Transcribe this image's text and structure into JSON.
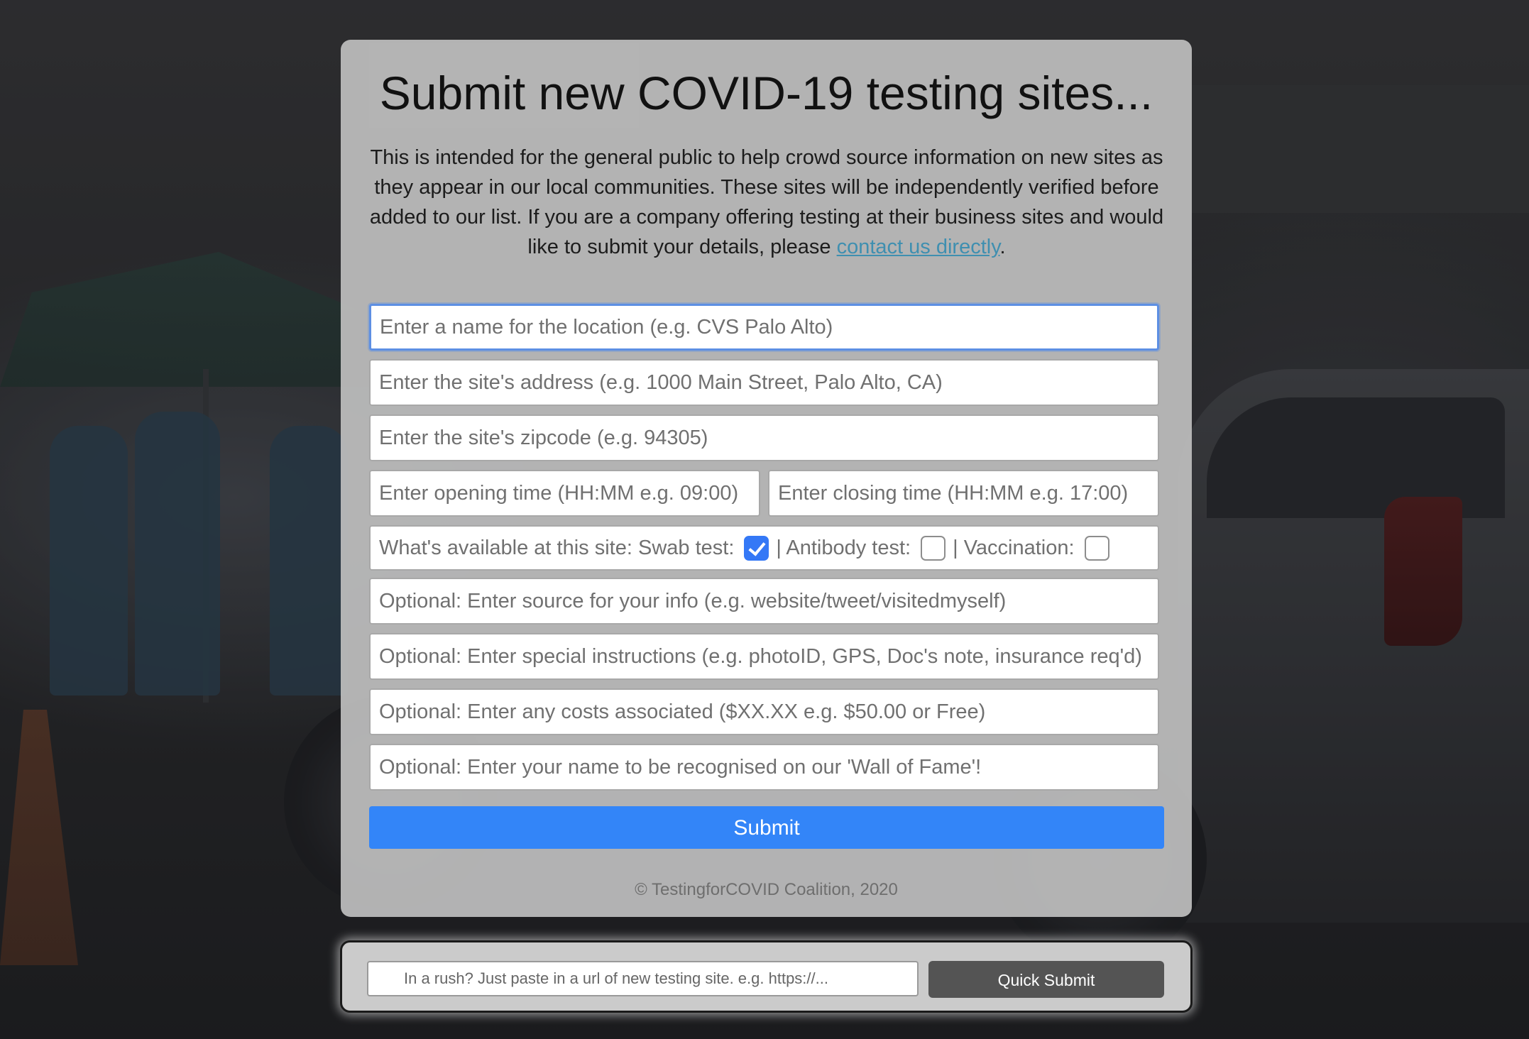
{
  "page": {
    "title": "Submit new COVID-19 testing sites...",
    "intro_text": "This is intended for the general public to help crowd source information on new sites as they appear in our local communities. These sites will be independently verified before added to our list. If you are a company offering testing at their business sites and would like to submit your details, please ",
    "intro_link": "contact us directly",
    "intro_end": "."
  },
  "form": {
    "location_name": {
      "value": "",
      "placeholder": "Enter a name for the location (e.g. CVS Palo Alto)"
    },
    "address": {
      "value": "",
      "placeholder": "Enter the site's address (e.g. 1000 Main Street, Palo Alto, CA)"
    },
    "zipcode": {
      "value": "",
      "placeholder": "Enter the site's zipcode (e.g. 94305)"
    },
    "opening_time": {
      "value": "",
      "placeholder": "Enter opening time (HH:MM e.g. 09:00)"
    },
    "closing_time": {
      "value": "",
      "placeholder": "Enter closing time (HH:MM e.g. 17:00)"
    },
    "availability": {
      "label": "What's available at this site: Swab test:",
      "antibody_label": "| Antibody test:",
      "vaccination_label": "| Vaccination:",
      "swab_checked": true,
      "antibody_checked": false,
      "vaccination_checked": false
    },
    "source": {
      "value": "",
      "placeholder": "Optional: Enter source for your info (e.g. website/tweet/visitedmyself)"
    },
    "instructions": {
      "value": "",
      "placeholder": "Optional: Enter special instructions (e.g. photoID, GPS, Doc's note, insurance req'd)"
    },
    "costs": {
      "value": "",
      "placeholder": "Optional: Enter any costs associated ($XX.XX e.g. $50.00 or Free)"
    },
    "contributor_name": {
      "value": "",
      "placeholder": "Optional: Enter your name to be recognised on our 'Wall of Fame'!"
    },
    "submit_label": "Submit"
  },
  "footer": {
    "copyright": "© TestingforCOVID Coalition, 2020"
  },
  "quick_submit": {
    "input_value": "",
    "input_placeholder": "In a rush? Just paste in a url of new testing site. e.g. https://...",
    "button_label": "Quick Submit"
  },
  "colors": {
    "submit_button": "#3385f8",
    "link": "#3f8fb0",
    "checkbox_checked": "#3478f6",
    "quick_submit_button": "#545454",
    "focus_ring": "#5d8fe3"
  },
  "icons": {
    "checkbox_checked": "checkmark-icon"
  }
}
